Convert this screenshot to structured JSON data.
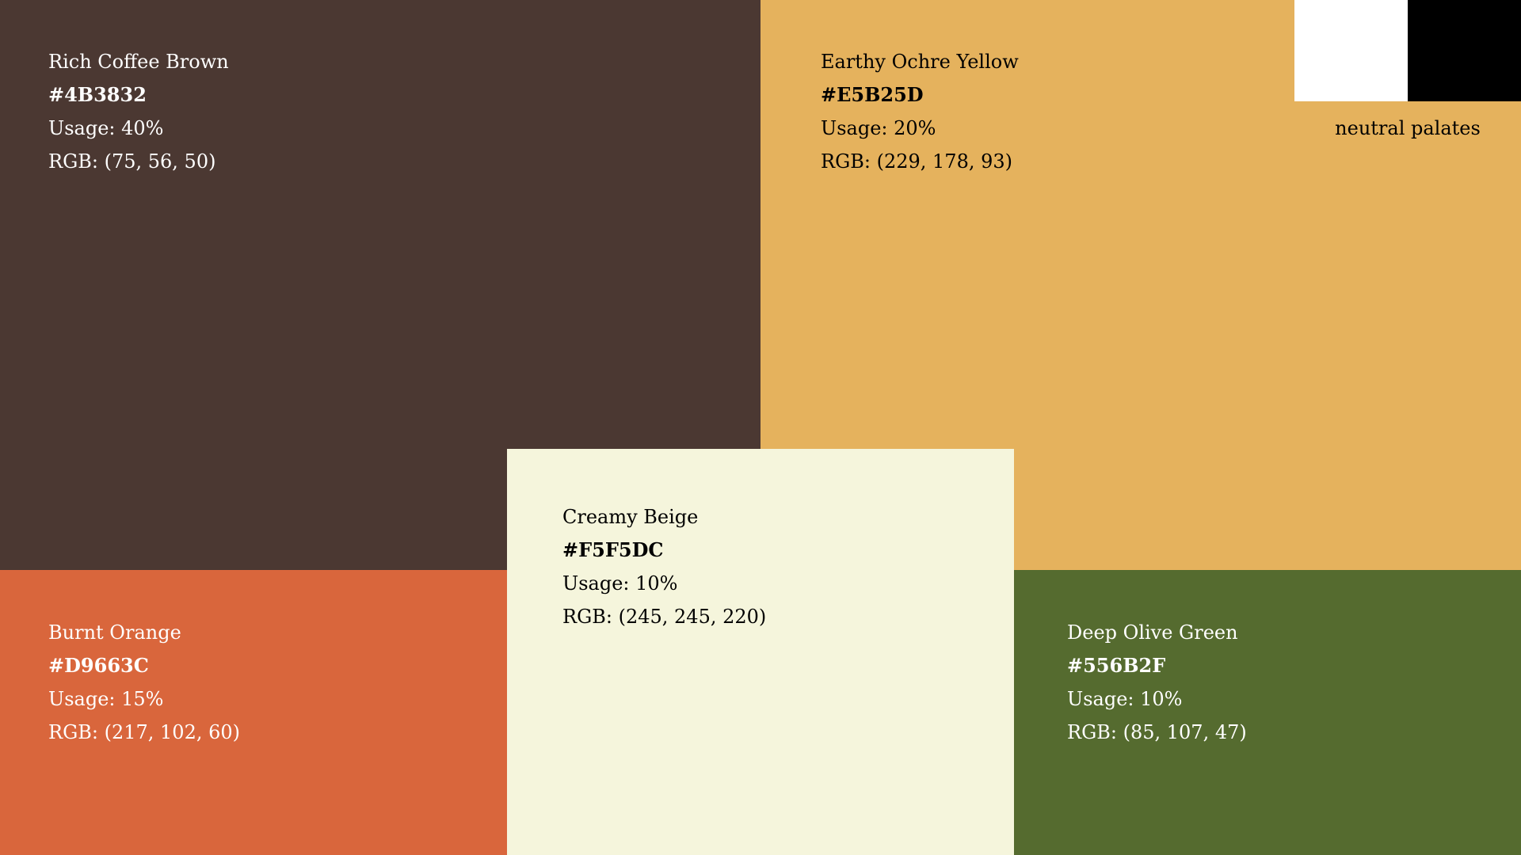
{
  "swatches": {
    "brown": {
      "name": "Rich Coffee Brown",
      "hex": "#4B3832",
      "usage": "Usage: 40%",
      "rgb": "RGB: (75, 56, 50)",
      "fill": "#4B3832",
      "text_color": "#ffffff"
    },
    "ochre": {
      "name": "Earthy Ochre Yellow",
      "hex": "#E5B25D",
      "usage": "Usage: 20%",
      "rgb": "RGB: (229, 178, 93)",
      "fill": "#E5B25D",
      "text_color": "#000000"
    },
    "orange": {
      "name": "Burnt Orange",
      "hex": "#D9663C",
      "usage": "Usage: 15%",
      "rgb": "RGB: (217, 102, 60)",
      "fill": "#D9663C",
      "text_color": "#ffffff"
    },
    "beige": {
      "name": "Creamy Beige",
      "hex": "#F5F5DC",
      "usage": "Usage: 10%",
      "rgb": "RGB: (245, 245, 220)",
      "fill": "#F5F5DC",
      "text_color": "#000000"
    },
    "olive": {
      "name": "Deep Olive Green",
      "hex": "#556B2F",
      "usage": "Usage: 10%",
      "rgb": "RGB: (85, 107, 47)",
      "fill": "#556B2F",
      "text_color": "#ffffff"
    }
  },
  "neutrals": {
    "label": "neutral palates",
    "white": "#ffffff",
    "black": "#000000"
  }
}
